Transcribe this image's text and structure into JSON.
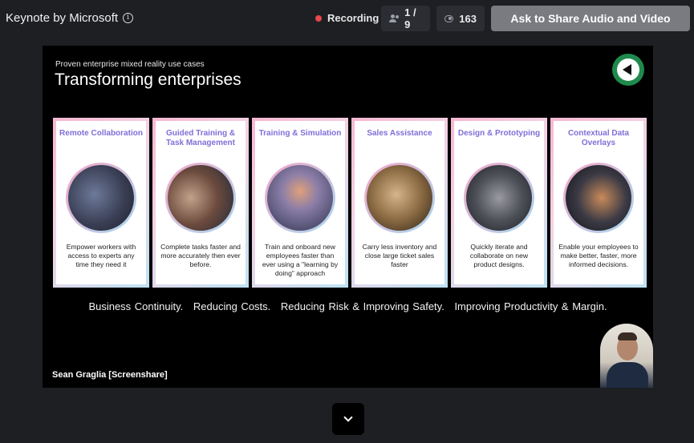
{
  "header": {
    "app_title": "Keynote by Microsoft",
    "info_icon": "info-icon",
    "recording_label": "Recording",
    "recording_color": "#e5484d",
    "participants": "1 / 9",
    "viewers": "163",
    "ask_button_label": "Ask to Share Audio and Video"
  },
  "slide": {
    "subtitle": "Proven enterprise mixed reality use cases",
    "title": "Transforming enterprises",
    "cards": [
      {
        "title": "Remote Collaboration",
        "desc": "Empower workers with access to experts any time they need it",
        "photo": "#3a3f55"
      },
      {
        "title": "Guided Training & Task Management",
        "desc": "Complete tasks faster and more accurately then ever before.",
        "photo": "#6b4a3d"
      },
      {
        "title": "Training & Simulation",
        "desc": "Train and onboard new employees faster than ever using a \"learning by doing\" approach",
        "photo": "#5a6a86"
      },
      {
        "title": "Sales Assistance",
        "desc": "Carry less inventory and close large ticket sales faster",
        "photo": "#8a6a42"
      },
      {
        "title": "Design & Prototyping",
        "desc": "Quickly iterate and collaborate on new product designs.",
        "photo": "#4d5058"
      },
      {
        "title": "Contextual Data Overlays",
        "desc": "Enable your employees to make better, faster, more informed decisions.",
        "photo": "#3b3a45"
      }
    ],
    "tagline": [
      "Business Continuity.",
      "Reducing Costs.",
      "Reducing Risk & Improving Safety.",
      "Improving Productivity & Margin."
    ]
  },
  "presenter_name": "Sean Graglia [Screenshare]",
  "accent_green": "#1e8a4c"
}
